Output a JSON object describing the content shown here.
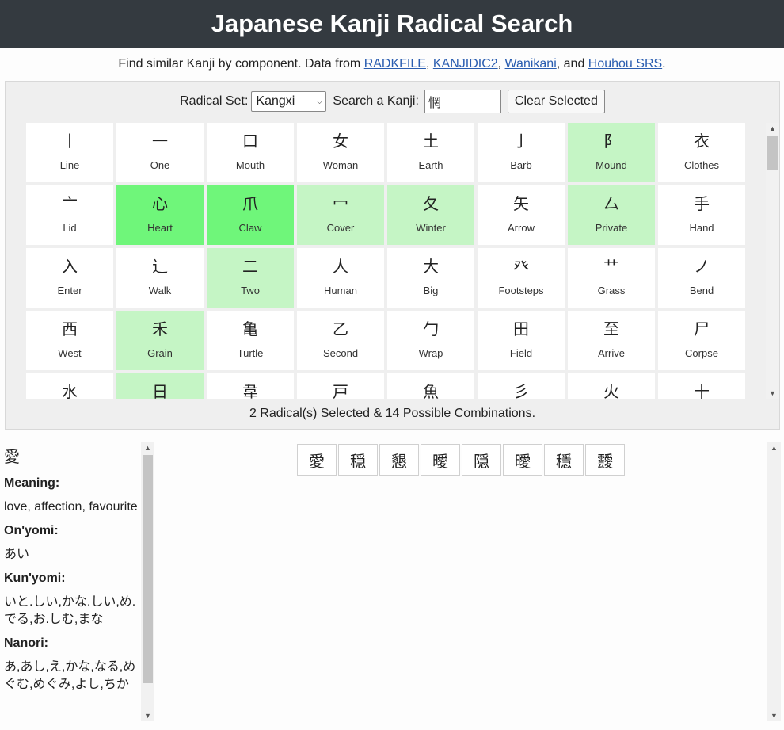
{
  "header": {
    "title": "Japanese Kanji Radical Search"
  },
  "subtitle": {
    "prefix": "Find similar Kanji by component. Data from ",
    "links": [
      "RADKFILE",
      "KANJIDIC2",
      "Wanikani",
      "Houhou SRS"
    ],
    "sep1": ", ",
    "sep2": ", ",
    "sep3": ", and ",
    "suffix": "."
  },
  "controls": {
    "radical_set_label": "Radical Set:",
    "radical_set_value": "Kangxi",
    "search_label": "Search a Kanji:",
    "search_value": "惘",
    "clear_button": "Clear Selected"
  },
  "radicals": [
    {
      "glyph": "丨",
      "name": "Line",
      "state": "normal"
    },
    {
      "glyph": "一",
      "name": "One",
      "state": "normal"
    },
    {
      "glyph": "口",
      "name": "Mouth",
      "state": "normal"
    },
    {
      "glyph": "女",
      "name": "Woman",
      "state": "normal"
    },
    {
      "glyph": "土",
      "name": "Earth",
      "state": "normal"
    },
    {
      "glyph": "亅",
      "name": "Barb",
      "state": "normal"
    },
    {
      "glyph": "阝",
      "name": "Mound",
      "state": "possible"
    },
    {
      "glyph": "衣",
      "name": "Clothes",
      "state": "normal"
    },
    {
      "glyph": "亠",
      "name": "Lid",
      "state": "normal"
    },
    {
      "glyph": "心",
      "name": "Heart",
      "state": "selected"
    },
    {
      "glyph": "爪",
      "name": "Claw",
      "state": "selected"
    },
    {
      "glyph": "冖",
      "name": "Cover",
      "state": "possible"
    },
    {
      "glyph": "夂",
      "name": "Winter",
      "state": "possible"
    },
    {
      "glyph": "矢",
      "name": "Arrow",
      "state": "normal"
    },
    {
      "glyph": "厶",
      "name": "Private",
      "state": "possible"
    },
    {
      "glyph": "手",
      "name": "Hand",
      "state": "normal"
    },
    {
      "glyph": "入",
      "name": "Enter",
      "state": "normal"
    },
    {
      "glyph": "辶",
      "name": "Walk",
      "state": "normal"
    },
    {
      "glyph": "二",
      "name": "Two",
      "state": "possible"
    },
    {
      "glyph": "人",
      "name": "Human",
      "state": "normal"
    },
    {
      "glyph": "大",
      "name": "Big",
      "state": "normal"
    },
    {
      "glyph": "癶",
      "name": "Footsteps",
      "state": "normal"
    },
    {
      "glyph": "艹",
      "name": "Grass",
      "state": "normal"
    },
    {
      "glyph": "ノ",
      "name": "Bend",
      "state": "normal"
    },
    {
      "glyph": "西",
      "name": "West",
      "state": "normal"
    },
    {
      "glyph": "禾",
      "name": "Grain",
      "state": "possible"
    },
    {
      "glyph": "亀",
      "name": "Turtle",
      "state": "normal"
    },
    {
      "glyph": "乙",
      "name": "Second",
      "state": "normal"
    },
    {
      "glyph": "勹",
      "name": "Wrap",
      "state": "normal"
    },
    {
      "glyph": "田",
      "name": "Field",
      "state": "normal"
    },
    {
      "glyph": "至",
      "name": "Arrive",
      "state": "normal"
    },
    {
      "glyph": "尸",
      "name": "Corpse",
      "state": "normal"
    },
    {
      "glyph": "水",
      "name": "",
      "state": "normal"
    },
    {
      "glyph": "日",
      "name": "",
      "state": "possible"
    },
    {
      "glyph": "韋",
      "name": "",
      "state": "normal"
    },
    {
      "glyph": "戸",
      "name": "",
      "state": "normal"
    },
    {
      "glyph": "魚",
      "name": "",
      "state": "normal"
    },
    {
      "glyph": "彡",
      "name": "",
      "state": "normal"
    },
    {
      "glyph": "火",
      "name": "",
      "state": "normal"
    },
    {
      "glyph": "十",
      "name": "",
      "state": "normal"
    }
  ],
  "status": "2 Radical(s) Selected & 14 Possible Combinations.",
  "info": {
    "kanji": "愛",
    "meaning_label": "Meaning:",
    "meaning": "love, affection, favourite",
    "onyomi_label": "On'yomi:",
    "onyomi": "あい",
    "kunyomi_label": "Kun'yomi:",
    "kunyomi": "いと.しい,かな.しい,め.でる,お.しむ,まな",
    "nanori_label": "Nanori:",
    "nanori": "あ,あし,え,かな,なる,めぐむ,めぐみ,よし,ちか"
  },
  "results": [
    "愛",
    "穏",
    "懇",
    "曖",
    "隠",
    "曖",
    "穩",
    "靉"
  ],
  "colors": {
    "header_bg": "#343a40",
    "selected": "#6ff67a",
    "possible": "#c5f5c5",
    "link": "#2a5db0"
  }
}
